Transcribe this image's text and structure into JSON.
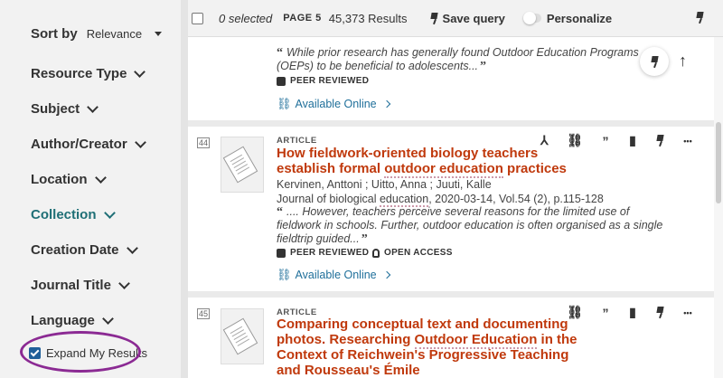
{
  "sidebar": {
    "sort_label": "Sort by",
    "sort_value": "Relevance",
    "facets": [
      {
        "label": "Resource Type"
      },
      {
        "label": "Subject"
      },
      {
        "label": "Author/Creator"
      },
      {
        "label": "Location"
      },
      {
        "label": "Collection"
      },
      {
        "label": "Creation Date"
      },
      {
        "label": "Journal Title"
      },
      {
        "label": "Language"
      }
    ],
    "expand_label": "Expand My Results"
  },
  "toolbar": {
    "selected": "0 selected",
    "page": "PAGE 5",
    "results": "45,373 Results",
    "save_query": "Save query",
    "personalize": "Personalize"
  },
  "results": [
    {
      "snippet": "While prior research has generally found Outdoor Education Programs (OEPs) to be beneficial to adolescents...",
      "peer_reviewed": "PEER REVIEWED",
      "available": "Available Online"
    },
    {
      "number": "44",
      "type": "ARTICLE",
      "title_a": "How fieldwork-oriented biology teachers establish formal ",
      "title_hl": "outdoor education",
      "title_b": " practices",
      "authors": "Kervinen, Anttoni ; Uitto, Anna ; Juuti, Kalle",
      "journal_a": "Journal of biological ",
      "journal_hl": "education",
      "journal_b": ", 2020-03-14, Vol.54 (2), p.115-128",
      "snippet": ".... However, teachers perceive several reasons for the limited use of fieldwork in schools. Further, outdoor education is often organised as a single fieldtrip guided...",
      "peer_reviewed": "PEER REVIEWED",
      "open_access": "OPEN ACCESS",
      "available": "Available Online"
    },
    {
      "number": "45",
      "type": "ARTICLE",
      "title_a": "Comparing conceptual text and documenting photos. Researching ",
      "title_hl": "Outdoor Education",
      "title_b": " in the Context of Reichwein's Progressive Teaching and Rousseau's Émile"
    }
  ],
  "icons": {
    "quote": "“",
    "quote_close": "”",
    "dots": "•••",
    "up": "↑",
    "link": "⛓"
  },
  "colors": {
    "accent": "#1f6f76",
    "title": "#c0390c",
    "link": "#1f6f9a",
    "highlight_ring": "#8b2a93"
  }
}
